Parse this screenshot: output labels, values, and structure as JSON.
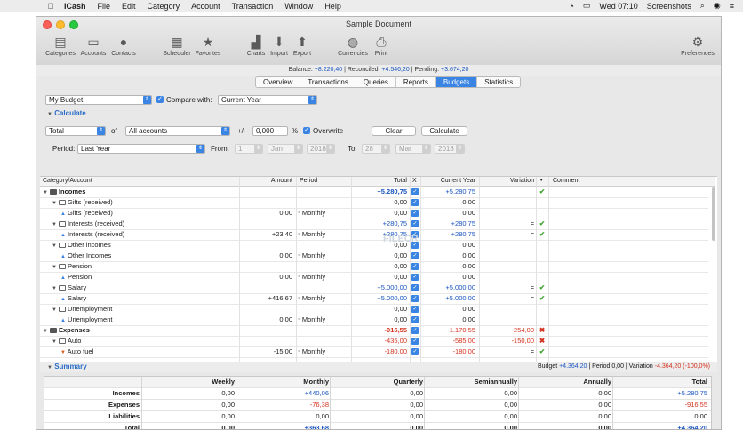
{
  "menubar": {
    "app": "iCash",
    "items": [
      "File",
      "Edit",
      "Category",
      "Account",
      "Transaction",
      "Window",
      "Help"
    ],
    "clock": "Wed 07:10",
    "screenshots": "Screenshots"
  },
  "window": {
    "title": "Sample Document",
    "toolbar": [
      "Categories",
      "Accounts",
      "Contacts",
      "Scheduler",
      "Favorites",
      "Charts",
      "Import",
      "Export",
      "Currencies",
      "Print",
      "Preferences"
    ]
  },
  "balance": {
    "label_balance": "Balance:",
    "balance": "+8.220,40",
    "label_reconciled": "| Reconciled:",
    "reconciled": "+4.546,20",
    "label_pending": "| Pending:",
    "pending": "+3.674,20"
  },
  "tabs": [
    "Overview",
    "Transactions",
    "Queries",
    "Reports",
    "Budgets",
    "Statistics"
  ],
  "budget": {
    "selected": "My Budget",
    "compare_label": "Compare with:",
    "compare_value": "Current Year",
    "calculate_header": "Calculate",
    "total_sel": "Total",
    "of_label": "of",
    "accounts_sel": "All accounts",
    "plusminus_label": "+/-",
    "plusminus_value": "0,000",
    "percent_label": "%",
    "overwrite_label": "Overwrite",
    "clear_button": "Clear",
    "calculate_button": "Calculate",
    "period_label": "Period:",
    "period_value": "Last Year",
    "from_label": "From:",
    "from_day": "1",
    "from_month": "Jan",
    "from_year": "2018",
    "to_label": "To:",
    "to_day": "28",
    "to_month": "Mar",
    "to_year": "2018"
  },
  "columns": [
    "Category/Account",
    "Amount",
    "Period",
    "Total",
    "X",
    "Current Year",
    "Variation",
    "•",
    "Comment"
  ],
  "rows": [
    {
      "cat": "Incomes",
      "lvl": 0,
      "kind": "group",
      "amt": "",
      "per": "",
      "tot": "+5.280,75",
      "cur": "+5.280,75",
      "var": "",
      "st": "check"
    },
    {
      "cat": "Gifts (received)",
      "lvl": 1,
      "kind": "folder",
      "amt": "",
      "per": "",
      "tot": "0,00",
      "cur": "0,00",
      "var": "",
      "st": ""
    },
    {
      "cat": "Gifts (received)",
      "lvl": 2,
      "kind": "leaf",
      "amt": "0,00",
      "per": "Monthly",
      "tot": "0,00",
      "cur": "0,00",
      "var": "",
      "st": ""
    },
    {
      "cat": "Interests (received)",
      "lvl": 1,
      "kind": "folder",
      "amt": "",
      "per": "",
      "tot": "+280,75",
      "cur": "+280,75",
      "var": "=",
      "st": "check"
    },
    {
      "cat": "Interests (received)",
      "lvl": 2,
      "kind": "leaf",
      "amt": "+23,40",
      "per": "Monthly",
      "tot": "+280,75",
      "cur": "+280,75",
      "var": "=",
      "st": "check"
    },
    {
      "cat": "Other incomes",
      "lvl": 1,
      "kind": "folder",
      "amt": "",
      "per": "",
      "tot": "0,00",
      "cur": "0,00",
      "var": "",
      "st": ""
    },
    {
      "cat": "Other Incomes",
      "lvl": 2,
      "kind": "leaf",
      "amt": "0,00",
      "per": "Monthly",
      "tot": "0,00",
      "cur": "0,00",
      "var": "",
      "st": ""
    },
    {
      "cat": "Pension",
      "lvl": 1,
      "kind": "folder",
      "amt": "",
      "per": "",
      "tot": "0,00",
      "cur": "0,00",
      "var": "",
      "st": ""
    },
    {
      "cat": "Pension",
      "lvl": 2,
      "kind": "leaf",
      "amt": "0,00",
      "per": "Monthly",
      "tot": "0,00",
      "cur": "0,00",
      "var": "",
      "st": ""
    },
    {
      "cat": "Salary",
      "lvl": 1,
      "kind": "folder",
      "amt": "",
      "per": "",
      "tot": "+5.000,00",
      "cur": "+5.000,00",
      "var": "=",
      "st": "check"
    },
    {
      "cat": "Salary",
      "lvl": 2,
      "kind": "leaf",
      "amt": "+416,67",
      "per": "Monthly",
      "tot": "+5.000,00",
      "cur": "+5.000,00",
      "var": "=",
      "st": "check"
    },
    {
      "cat": "Unemployment",
      "lvl": 1,
      "kind": "folder",
      "amt": "",
      "per": "",
      "tot": "0,00",
      "cur": "0,00",
      "var": "",
      "st": ""
    },
    {
      "cat": "Unemployment",
      "lvl": 2,
      "kind": "leaf",
      "amt": "0,00",
      "per": "Monthly",
      "tot": "0,00",
      "cur": "0,00",
      "var": "",
      "st": ""
    },
    {
      "cat": "Expenses",
      "lvl": 0,
      "kind": "group",
      "amt": "",
      "per": "",
      "tot": "-916,55",
      "cur": "-1.170,55",
      "var": "-254,00",
      "st": "cross"
    },
    {
      "cat": "Auto",
      "lvl": 1,
      "kind": "folder",
      "amt": "",
      "per": "",
      "tot": "-435,00",
      "cur": "-585,00",
      "var": "-150,00",
      "st": "cross"
    },
    {
      "cat": "Auto fuel",
      "lvl": 2,
      "kind": "leaf-exp",
      "amt": "-15,00",
      "per": "Monthly",
      "tot": "-180,00",
      "cur": "-180,00",
      "var": "=",
      "st": "check"
    }
  ],
  "summary": {
    "title": "Summary",
    "budget_label": "Budget",
    "budget_value": "+4.364,20",
    "period_text": "| Period 0,00 | Variation",
    "variation_value": "-4.364,20 (-100,0%)",
    "columns": [
      "Weekly",
      "Monthly",
      "Quarterly",
      "Semiannually",
      "Annually",
      "Total"
    ],
    "rows": [
      {
        "label": "Incomes",
        "values": [
          "0,00",
          "+440,06",
          "0,00",
          "0,00",
          "0,00",
          "+5.280,75"
        ]
      },
      {
        "label": "Expenses",
        "values": [
          "0,00",
          "-76,38",
          "0,00",
          "0,00",
          "0,00",
          "-916,55"
        ]
      },
      {
        "label": "Liabilities",
        "values": [
          "0,00",
          "0,00",
          "0,00",
          "0,00",
          "0,00",
          "0,00"
        ]
      },
      {
        "label": "Total",
        "values": [
          "0,00",
          "+363,68",
          "0,00",
          "0,00",
          "0,00",
          "+4.364,20"
        ]
      }
    ]
  },
  "watermark": "FILECR"
}
